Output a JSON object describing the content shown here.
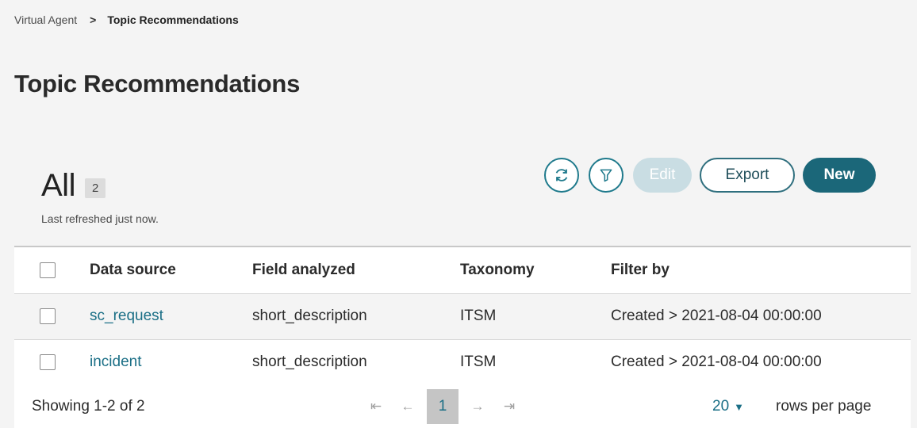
{
  "breadcrumb": {
    "parent": "Virtual Agent",
    "separator": ">",
    "current": "Topic Recommendations"
  },
  "page_title": "Topic Recommendations",
  "list": {
    "title": "All",
    "count": "2",
    "last_refreshed": "Last refreshed just now."
  },
  "toolbar": {
    "refresh_icon": "refresh-icon",
    "filter_icon": "filter-icon",
    "edit_label": "Edit",
    "export_label": "Export",
    "new_label": "New",
    "accent_color": "#1b6779"
  },
  "table": {
    "columns": [
      "Data source",
      "Field analyzed",
      "Taxonomy",
      "Filter by"
    ],
    "rows": [
      {
        "data_source": "sc_request",
        "field_analyzed": "short_description",
        "taxonomy": "ITSM",
        "filter_by": "Created > 2021-08-04 00:00:00"
      },
      {
        "data_source": "incident",
        "field_analyzed": "short_description",
        "taxonomy": "ITSM",
        "filter_by": "Created > 2021-08-04 00:00:00"
      }
    ]
  },
  "footer": {
    "showing": "Showing 1-2 of 2",
    "first_icon": "first-page-icon",
    "prev_icon": "prev-page-icon",
    "current_page": "1",
    "next_icon": "next-page-icon",
    "last_icon": "last-page-icon",
    "rows_per_page_value": "20",
    "rows_per_page_label": "rows per page"
  }
}
